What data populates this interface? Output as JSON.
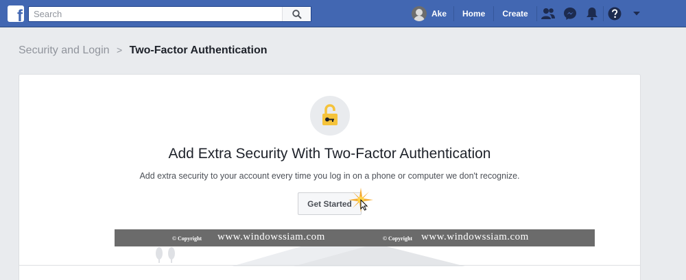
{
  "topbar": {
    "logo": "f",
    "search_placeholder": "Search",
    "profile_name": "Ake",
    "home": "Home",
    "create": "Create",
    "icons": [
      "friends-icon",
      "messenger-icon",
      "notifications-icon",
      "help-icon",
      "menu-caret-icon"
    ]
  },
  "breadcrumb": {
    "parent": "Security and Login",
    "separator": ">",
    "current": "Two-Factor Authentication"
  },
  "card": {
    "title": "Add Extra Security With Two-Factor Authentication",
    "description": "Add extra security to your account every time you log in on a phone or computer we don't recognize.",
    "button": "Get Started"
  },
  "watermark": {
    "copyright": "© Copyright",
    "site": "www.windowssiam.com"
  },
  "colors": {
    "brand": "#4267b2",
    "page_bg": "#e9ebee",
    "lock": "#f5c33b"
  }
}
